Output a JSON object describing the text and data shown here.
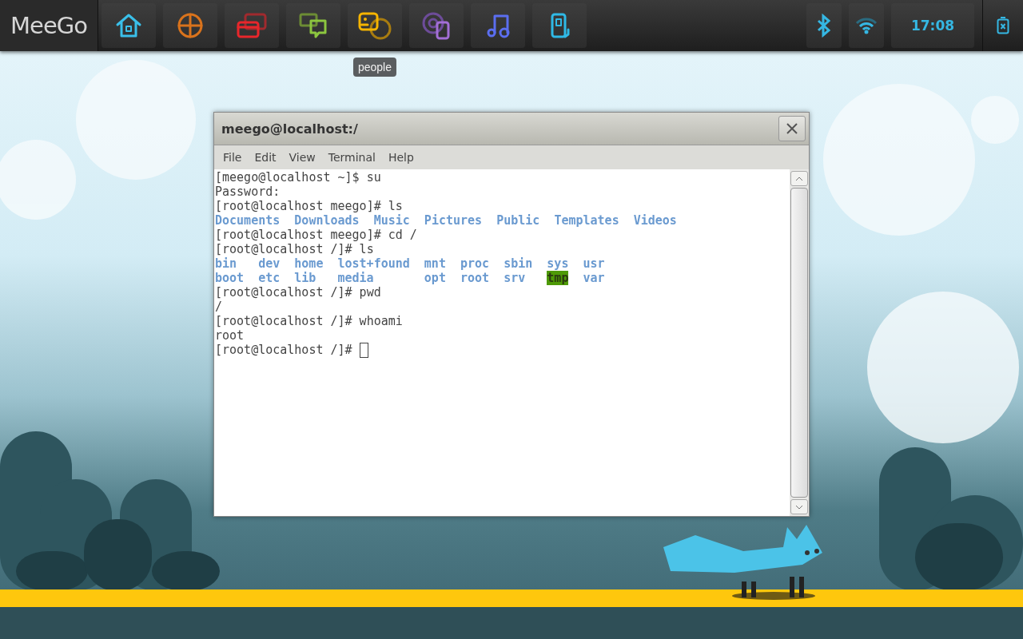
{
  "panel": {
    "logo": "MeeGo",
    "apps": [
      {
        "kind": "home",
        "color": "#3ac0ea"
      },
      {
        "kind": "grid",
        "color": "#d9731c"
      },
      {
        "kind": "windows",
        "color": "#e8262b"
      },
      {
        "kind": "chat",
        "color": "#8cc63f"
      },
      {
        "kind": "people",
        "color": "#f5b400",
        "tooltip": "people"
      },
      {
        "kind": "camera",
        "color": "#a36fd6"
      },
      {
        "kind": "music",
        "color": "#5b6ef0"
      },
      {
        "kind": "phone",
        "color": "#2fb9e6"
      }
    ],
    "status": {
      "clock": "17:08"
    }
  },
  "window": {
    "title": "meego@localhost:/",
    "menu": [
      "File",
      "Edit",
      "View",
      "Terminal",
      "Help"
    ],
    "lines": [
      {
        "kind": "text",
        "text": "[meego@localhost ~]$ su"
      },
      {
        "kind": "text",
        "text": "Password:"
      },
      {
        "kind": "text",
        "text": "[root@localhost meego]# ls"
      },
      {
        "kind": "listing",
        "rows": [
          [
            {
              "name": "Documents",
              "highlighted": false
            },
            {
              "name": "Downloads",
              "highlighted": false
            },
            {
              "name": "Music",
              "highlighted": false
            },
            {
              "name": "Pictures",
              "highlighted": false
            },
            {
              "name": "Public",
              "highlighted": false
            },
            {
              "name": "Templates",
              "highlighted": false
            },
            {
              "name": "Videos",
              "highlighted": false
            }
          ]
        ]
      },
      {
        "kind": "text",
        "text": "[root@localhost meego]# cd /"
      },
      {
        "kind": "text",
        "text": "[root@localhost /]# ls"
      },
      {
        "kind": "listing",
        "rows": [
          [
            {
              "name": "bin",
              "highlighted": false
            },
            {
              "name": "dev",
              "highlighted": false
            },
            {
              "name": "home",
              "highlighted": false
            },
            {
              "name": "lost+found",
              "highlighted": false
            },
            {
              "name": "mnt",
              "highlighted": false
            },
            {
              "name": "proc",
              "highlighted": false
            },
            {
              "name": "sbin",
              "highlighted": false
            },
            {
              "name": "sys",
              "highlighted": false
            },
            {
              "name": "usr",
              "highlighted": false
            }
          ],
          [
            {
              "name": "boot",
              "highlighted": false
            },
            {
              "name": "etc",
              "highlighted": false
            },
            {
              "name": "lib",
              "highlighted": false
            },
            {
              "name": "media",
              "highlighted": false
            },
            {
              "name": "opt",
              "highlighted": false
            },
            {
              "name": "root",
              "highlighted": false
            },
            {
              "name": "srv",
              "highlighted": false
            },
            {
              "name": "tmp",
              "highlighted": true
            },
            {
              "name": "var",
              "highlighted": false
            }
          ]
        ]
      },
      {
        "kind": "text",
        "text": "[root@localhost /]# pwd"
      },
      {
        "kind": "text",
        "text": "/"
      },
      {
        "kind": "text",
        "text": "[root@localhost /]# whoami"
      },
      {
        "kind": "text",
        "text": "root"
      },
      {
        "kind": "prompt",
        "text": "[root@localhost /]#"
      }
    ]
  }
}
